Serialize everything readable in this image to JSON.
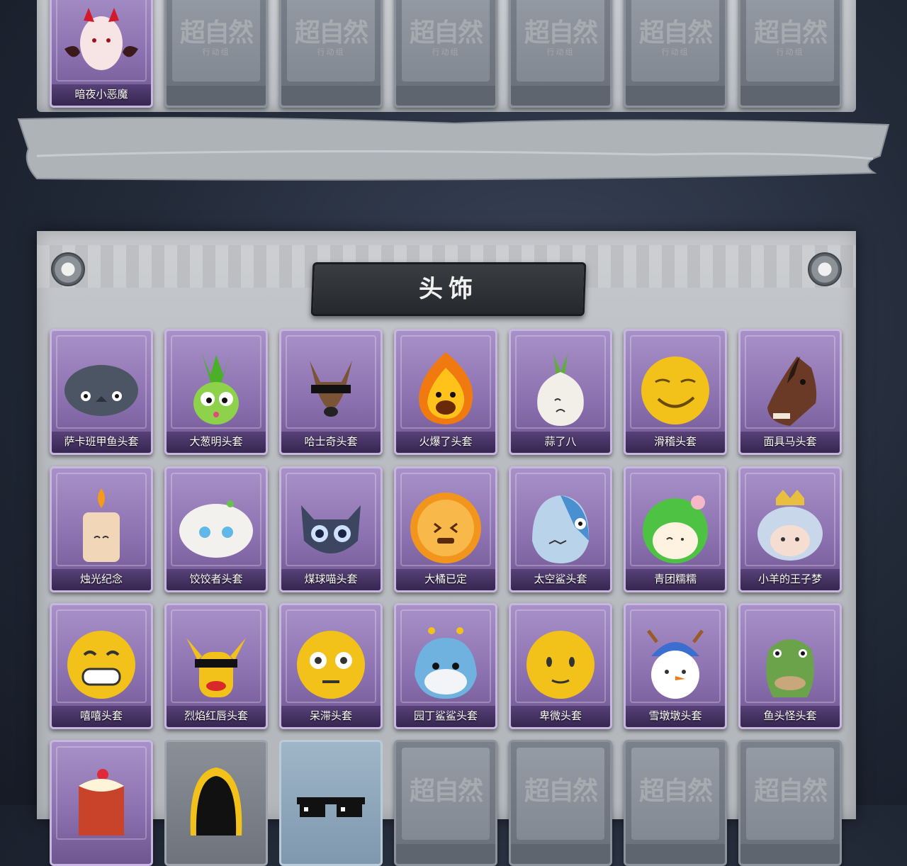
{
  "top_row": [
    {
      "label": "暗夜小恶魔",
      "state": "owned",
      "icon": "little-devil-icon"
    },
    {
      "state": "locked",
      "watermark": "超自然",
      "watermark_sub": "行动组"
    },
    {
      "state": "locked",
      "watermark": "超自然",
      "watermark_sub": "行动组"
    },
    {
      "state": "locked",
      "watermark": "超自然",
      "watermark_sub": "行动组"
    },
    {
      "state": "locked",
      "watermark": "超自然",
      "watermark_sub": "行动组"
    },
    {
      "state": "locked",
      "watermark": "超自然",
      "watermark_sub": "行动组"
    },
    {
      "state": "locked",
      "watermark": "超自然",
      "watermark_sub": "行动组"
    }
  ],
  "section": {
    "title": "头饰"
  },
  "rows": [
    [
      {
        "label": "萨卡班甲鱼头套",
        "icon": "fish-head-icon",
        "color": "#4b5564"
      },
      {
        "label": "大葱明头套",
        "icon": "scallion-head-icon",
        "color": "#5fbf3a"
      },
      {
        "label": "哈士奇头套",
        "icon": "husky-head-icon",
        "color": "#7a5436"
      },
      {
        "label": "火爆了头套",
        "icon": "flame-head-icon",
        "color": "#f08a1a"
      },
      {
        "label": "蒜了八",
        "icon": "garlic-head-icon",
        "color": "#eeeae2"
      },
      {
        "label": "滑稽头套",
        "icon": "funny-face-icon",
        "color": "#f2c21a"
      },
      {
        "label": "面具马头套",
        "icon": "horse-mask-icon",
        "color": "#6b3a26"
      }
    ],
    [
      {
        "label": "烛光纪念",
        "icon": "candle-head-icon",
        "color": "#f1d6b8"
      },
      {
        "label": "饺饺者头套",
        "icon": "dumpling-head-icon",
        "color": "#f3f1ee"
      },
      {
        "label": "煤球喵头套",
        "icon": "cat-head-icon",
        "color": "#3d4660"
      },
      {
        "label": "大橘已定",
        "icon": "orange-slice-icon",
        "color": "#f2951c"
      },
      {
        "label": "太空鲨头套",
        "icon": "shark-head-icon",
        "color": "#b9d3ea"
      },
      {
        "label": "青团糯糯",
        "icon": "rice-ball-icon",
        "color": "#4ec243"
      },
      {
        "label": "小羊的王子梦",
        "icon": "sheep-prince-icon",
        "color": "#c9d7ea"
      }
    ],
    [
      {
        "label": "嘻嘻头套",
        "icon": "grin-face-icon",
        "color": "#f2c21a"
      },
      {
        "label": "烈焰红唇头套",
        "icon": "pikachu-mask-icon",
        "color": "#f2c21a"
      },
      {
        "label": "呆滞头套",
        "icon": "stunned-face-icon",
        "color": "#f2c21a"
      },
      {
        "label": "园丁鲨鲨头套",
        "icon": "gardener-shark-icon",
        "color": "#6fb2e0"
      },
      {
        "label": "卑微头套",
        "icon": "humble-face-icon",
        "color": "#f2c21a"
      },
      {
        "label": "雪墩墩头套",
        "icon": "snowman-head-icon",
        "color": "#ffffff"
      },
      {
        "label": "鱼头怪头套",
        "icon": "fish-monster-icon",
        "color": "#6aa34a"
      }
    ],
    [
      {
        "label": "",
        "icon": "pudding-head-icon",
        "color": "#c8432a",
        "state": "owned"
      },
      {
        "label": "",
        "icon": "astronaut-helmet-icon",
        "color": "#222",
        "state": "locked-dark"
      },
      {
        "label": "",
        "icon": "pixel-sunglasses-icon",
        "color": "#111",
        "state": "blue"
      },
      {
        "state": "locked",
        "watermark": "超自然"
      },
      {
        "state": "locked",
        "watermark": "超自然"
      },
      {
        "state": "locked",
        "watermark": "超自然"
      },
      {
        "state": "locked",
        "watermark": "超自然"
      }
    ]
  ]
}
